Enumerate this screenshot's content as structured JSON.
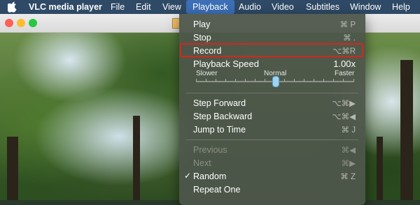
{
  "menubar": {
    "app_name": "VLC media player",
    "items": [
      "File",
      "Edit",
      "View",
      "Playback",
      "Audio",
      "Video",
      "Subtitles",
      "Window",
      "Help"
    ],
    "active_item": "Playback"
  },
  "playback_menu": {
    "play": {
      "label": "Play",
      "shortcut": "⌘ P"
    },
    "stop": {
      "label": "Stop",
      "shortcut": "⌘ ."
    },
    "record": {
      "label": "Record",
      "shortcut": "⌥⌘R"
    },
    "speed": {
      "label": "Playback Speed",
      "value": "1.00x",
      "slower_label": "Slower",
      "normal_label": "Normal",
      "faster_label": "Faster"
    },
    "step_forward": {
      "label": "Step Forward",
      "shortcut": "⌥⌘▶"
    },
    "step_backward": {
      "label": "Step Backward",
      "shortcut": "⌥⌘◀"
    },
    "jump_to_time": {
      "label": "Jump to Time",
      "shortcut": "⌘ J"
    },
    "previous": {
      "label": "Previous",
      "shortcut": "⌘◀"
    },
    "next": {
      "label": "Next",
      "shortcut": "⌘▶"
    },
    "random": {
      "label": "Random",
      "shortcut": "⌘ Z",
      "checked": "✓"
    },
    "repeat_one": {
      "label": "Repeat One"
    }
  },
  "colors": {
    "menubar_bg": "#2f4a66",
    "active_menu_bg": "#3c6fb5",
    "highlight_border": "#d9241c",
    "slider_thumb": "#9fd3f0"
  },
  "icons": {
    "apple": "apple-logo-icon",
    "window_controls": [
      "close-icon",
      "minimize-icon",
      "zoom-icon"
    ],
    "document": "vlc-document-icon"
  }
}
